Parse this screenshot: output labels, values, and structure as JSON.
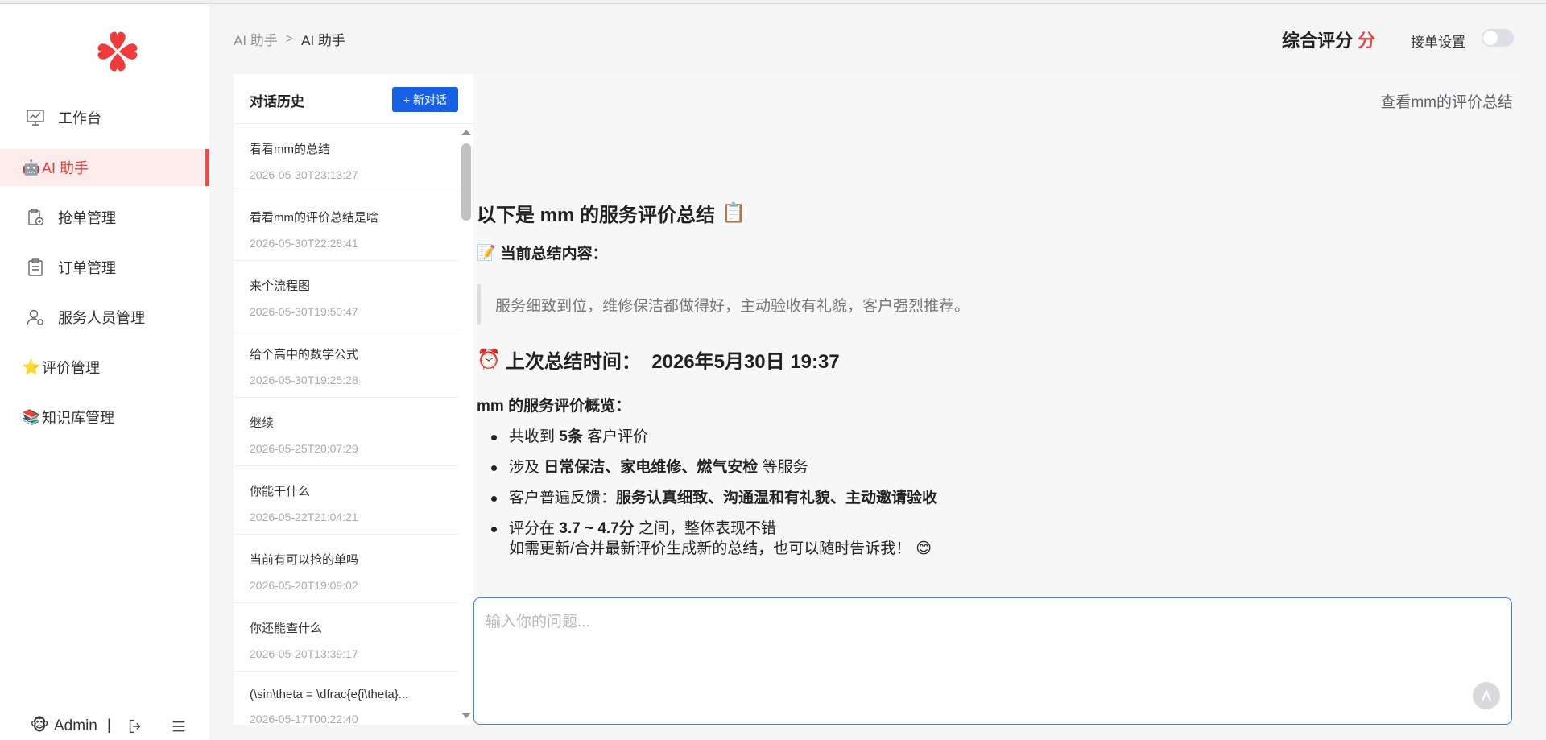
{
  "sidebar": {
    "items": [
      {
        "label": "工作台",
        "icon": "monitor-chart-icon"
      },
      {
        "label": "AI 助手",
        "icon": "robot-face-icon",
        "emoji": "🤖",
        "active": true
      },
      {
        "label": "抢单管理",
        "icon": "clipboard-add-icon"
      },
      {
        "label": "订单管理",
        "icon": "clipboard-list-icon"
      },
      {
        "label": "服务人员管理",
        "icon": "user-gear-icon"
      },
      {
        "label": "评价管理",
        "icon": "star-icon",
        "emoji": "⭐"
      },
      {
        "label": "知识库管理",
        "icon": "books-icon",
        "emoji": "📚"
      }
    ],
    "footer": {
      "avatar_emoji": "🐵",
      "user": "Admin",
      "separator": "|"
    }
  },
  "header": {
    "breadcrumb": {
      "root": "AI 助手",
      "separator": ">",
      "current": "AI 助手"
    },
    "rating_label": "综合评分",
    "rating_unit": "分",
    "order_setting_label": "接单设置",
    "order_setting_on": false
  },
  "history": {
    "title": "对话历史",
    "new_button": "+ 新对话",
    "items": [
      {
        "title": "看看mm的总结",
        "time": "2026-05-30T23:13:27"
      },
      {
        "title": "看看mm的评价总结是啥",
        "time": "2026-05-30T22:28:41"
      },
      {
        "title": "来个流程图",
        "time": "2026-05-30T19:50:47"
      },
      {
        "title": "给个高中的数学公式",
        "time": "2026-05-30T19:25:28"
      },
      {
        "title": "继续",
        "time": "2026-05-25T20:07:29"
      },
      {
        "title": "你能干什么",
        "time": "2026-05-22T21:04:21"
      },
      {
        "title": "当前有可以抢的单吗",
        "time": "2026-05-20T19:09:02"
      },
      {
        "title": "你还能查什么",
        "time": "2026-05-20T13:39:17"
      },
      {
        "title": "(\\sin\\theta = \\dfrac{e{i\\theta}...",
        "time": "2026-05-17T00:22:40"
      }
    ]
  },
  "chat": {
    "user_message": "查看mm的评价总结",
    "answer": {
      "heading": "以下是 mm 的服务评价总结",
      "heading_emoji": "📋",
      "current_label": "当前总结内容：",
      "current_emoji": "📝",
      "quote": "服务细致到位，维修保洁都做得好，主动验收有礼貌，客户强烈推荐。",
      "time_heading": "上次总结时间：  2026年5月30日 19:37",
      "time_emoji": "⏰",
      "overview_title": "mm 的服务评价概览：",
      "bullets": [
        {
          "pre": "共收到 ",
          "bold": "5条",
          "post": " 客户评价"
        },
        {
          "pre": "涉及 ",
          "bold": "日常保洁、家电维修、燃气安检",
          "post": " 等服务"
        },
        {
          "pre": "客户普遍反馈：",
          "bold": "服务认真细致、沟通温和有礼貌、主动邀请验收",
          "post": ""
        },
        {
          "pre": "评分在 ",
          "bold": "3.7 ~ 4.7分",
          "post": " 之间，整体表现不错"
        }
      ],
      "note": "如需更新/合并最新评价生成新的总结，也可以随时告诉我！",
      "note_emoji": "😊"
    },
    "input_placeholder": "输入你的问题..."
  }
}
